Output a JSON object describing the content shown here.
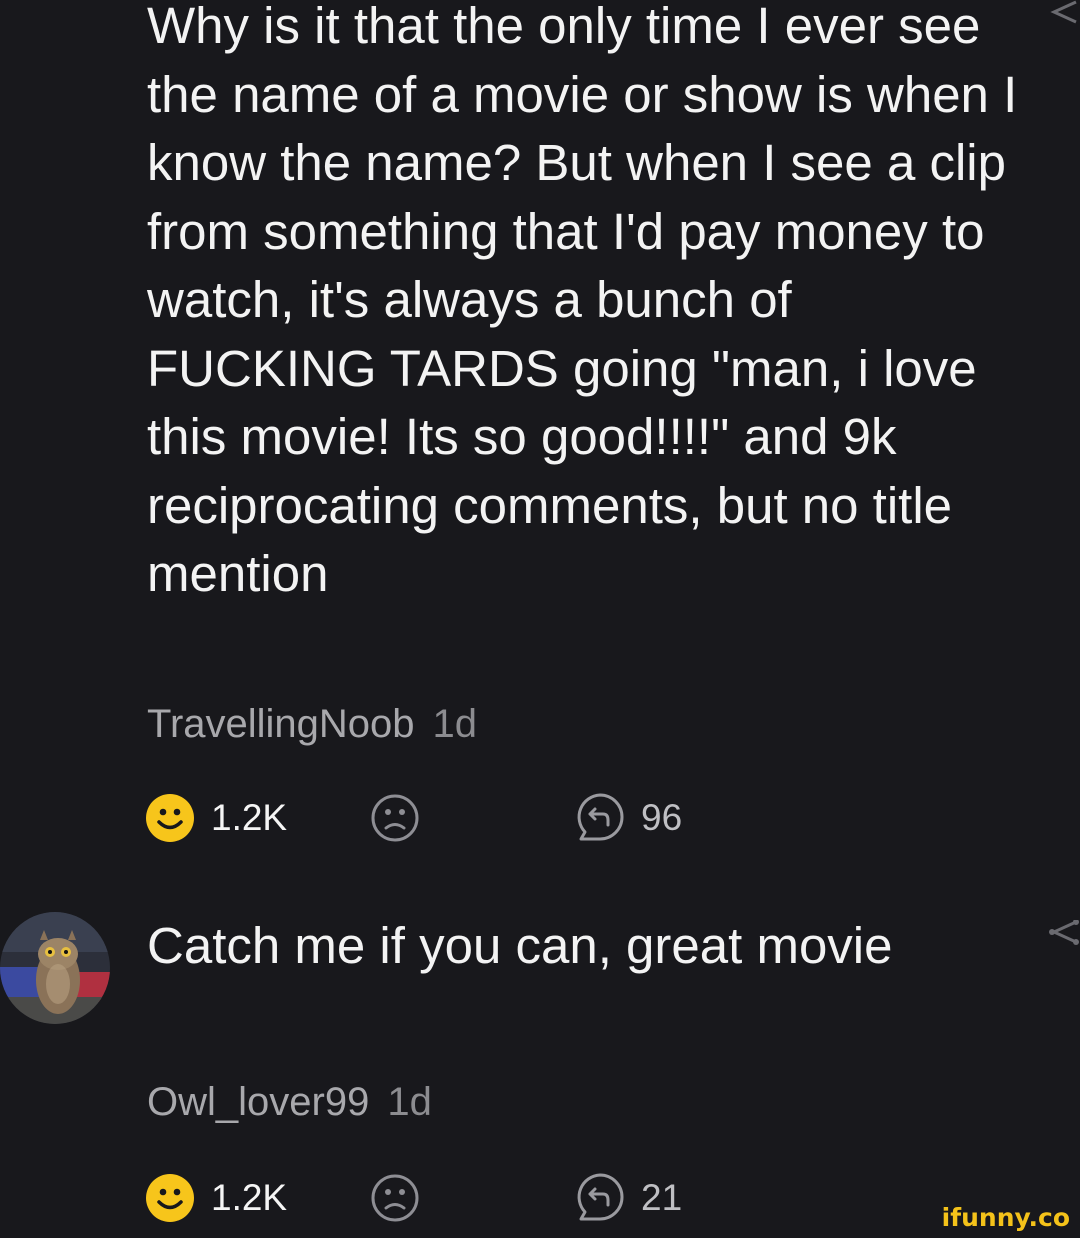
{
  "comments": [
    {
      "text": "Why is it that the only time I ever see the name of a movie or show is when I know the name? But when I see a clip from something that I'd pay money to watch, it's always a bunch of FUCKING TARDS going \"man, i love this movie! Its so good!!!!\" and 9k reciprocating comments, but no title mention",
      "username": "TravellingNoob",
      "time": "1d",
      "smiles": "1.2K",
      "replies": "96"
    },
    {
      "text": "Catch me if you can, great movie",
      "username": "Owl_lover99",
      "time": "1d",
      "smiles": "1.2K",
      "replies": "21"
    }
  ],
  "watermark": "ifunny.co",
  "colors": {
    "background": "#18181c",
    "smile_yellow": "#f7c51b",
    "watermark": "#f4c21a"
  },
  "icons": [
    "smile-icon",
    "frown-icon",
    "reply-icon",
    "share-icon",
    "avatar"
  ]
}
